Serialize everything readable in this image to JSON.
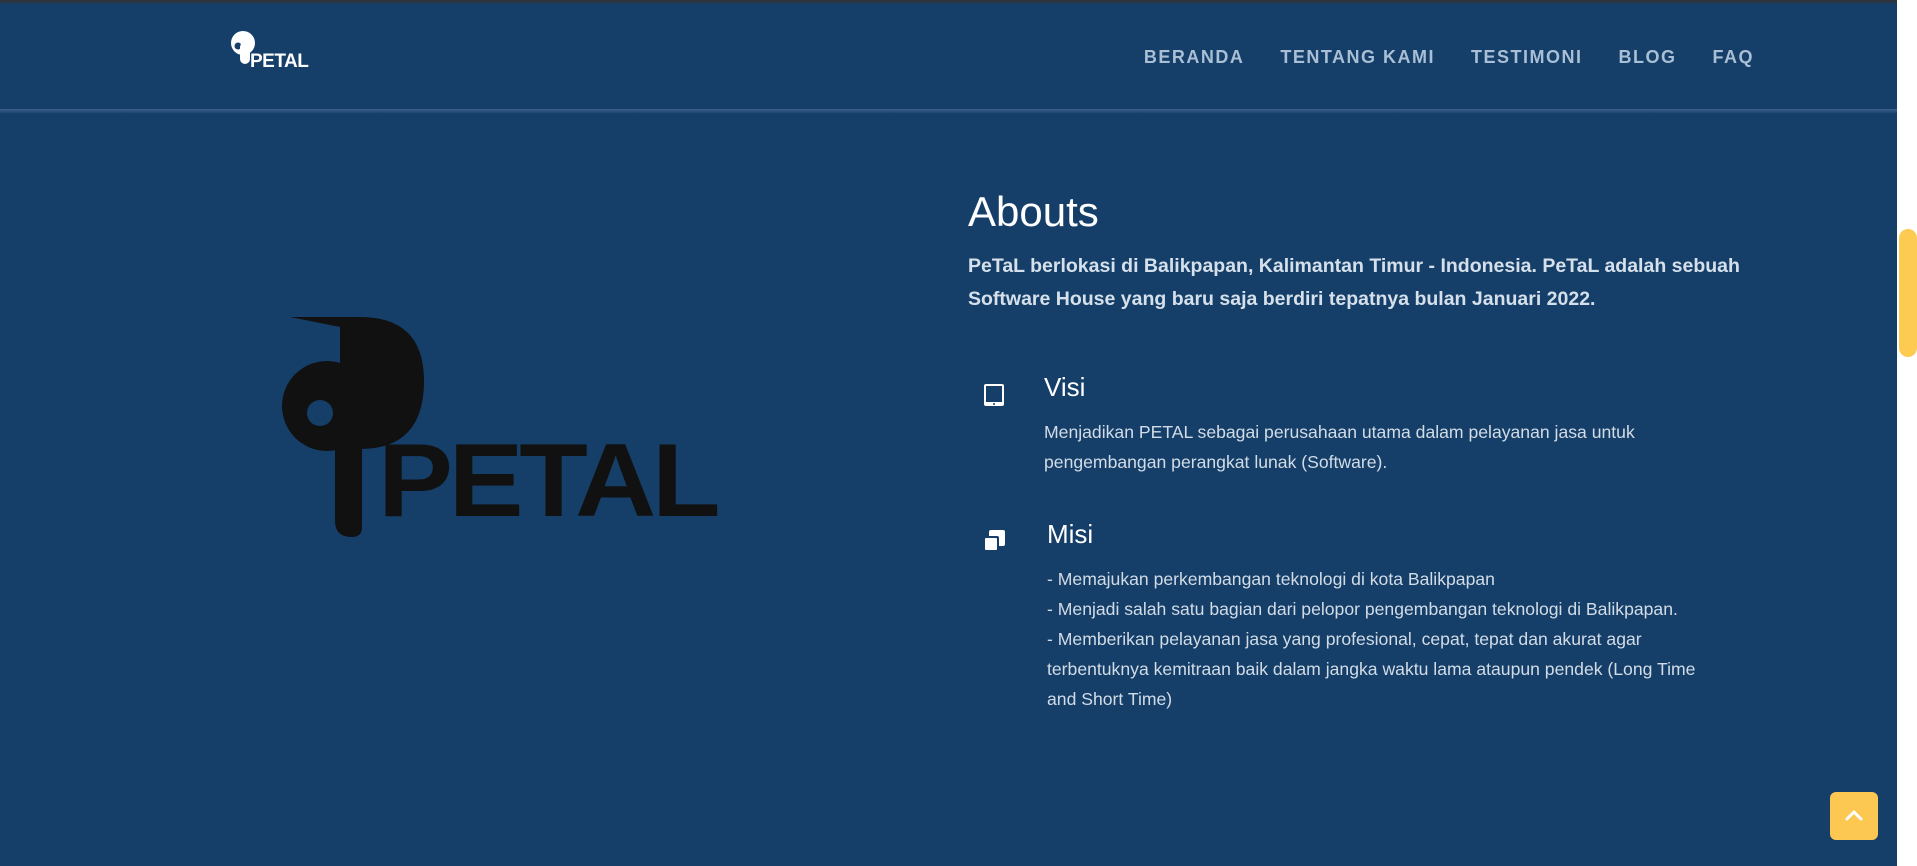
{
  "header": {
    "brand": "PETAL",
    "nav": [
      "BERANDA",
      "TENTANG KAMI",
      "TESTIMONI",
      "BLOG",
      "FAQ"
    ]
  },
  "about": {
    "logo_text": "PETAL",
    "title": "Abouts",
    "intro_line_1": "PeTaL berlokasi di Balikpapan, Kalimantan Timur - Indonesia. PeTaL adalah sebuah",
    "intro_line_2": "Software House yang baru saja berdiri tepatnya bulan Januari 2022.",
    "visi": {
      "icon": "tablet-icon",
      "title": "Visi",
      "line_1": "Menjadikan PETAL sebagai perusahaan utama dalam pelayanan jasa untuk",
      "line_2": "pengembangan perangkat lunak (Software)."
    },
    "misi": {
      "icon": "copy-icon",
      "title": "Misi",
      "line_1": "- Memajukan perkembangan teknologi di kota Balikpapan",
      "line_2": "- Menjadi salah satu bagian dari pelopor pengembangan teknologi di Balikpapan.",
      "line_3": "- Memberikan pelayanan jasa yang profesional, cepat, tepat dan akurat agar",
      "line_4": "terbentuknya kemitraan baik dalam jangka waktu lama ataupun pendek (Long Time",
      "line_5": "and Short Time)"
    }
  },
  "back_to_top": {
    "icon": "chevron-up-icon"
  },
  "colors": {
    "background": "#153f69",
    "nav_text": "#a8bfd5",
    "heading": "#ffffff",
    "body_text": "#d2dce6",
    "accent": "#fdc851",
    "logo": "#111111"
  }
}
